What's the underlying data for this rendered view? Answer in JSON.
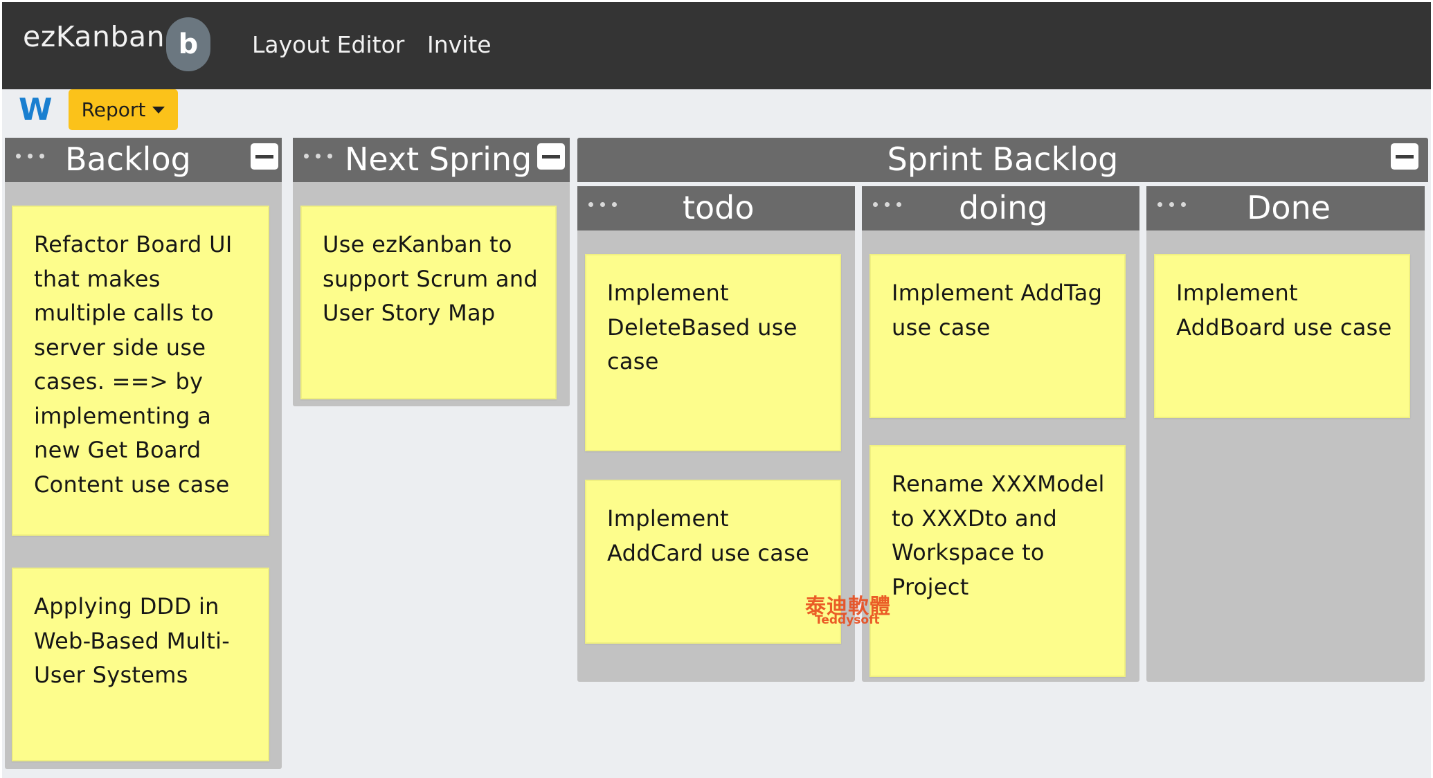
{
  "navbar": {
    "brand": "ezKanban",
    "badge": "b",
    "links": [
      "Layout Editor",
      "Invite"
    ]
  },
  "toolbar": {
    "workspace_logo": "W",
    "report_label": "Report"
  },
  "lanes": {
    "backlog": {
      "title": "Backlog",
      "cards": [
        "Refactor Board UI that makes multiple calls to server side use cases. ==> by implementing a new Get Board Content use case",
        "Applying DDD in Web-Based Multi-User Systems"
      ]
    },
    "next_spring": {
      "title": "Next Spring",
      "cards": [
        "Use ezKanban to support Scrum and User Story Map"
      ]
    },
    "sprint_backlog": {
      "title": "Sprint Backlog",
      "todo": {
        "title": "todo",
        "cards": [
          "Implement DeleteBased use case",
          "Implement AddCard use case"
        ]
      },
      "doing": {
        "title": "doing",
        "cards": [
          "Implement AddTag use case",
          "Rename XXXModel to XXXDto and Workspace to Project"
        ]
      },
      "done": {
        "title": "Done",
        "cards": [
          "Implement AddBoard use case"
        ]
      }
    }
  },
  "watermark": {
    "line1": "泰迪軟體",
    "line2": "Teddysoft"
  },
  "colors": {
    "navbar": "#343434",
    "lane_header": "#6a6a6a",
    "lane_body": "#c2c2c2",
    "card": "#fdfd8c",
    "report_button": "#fbc21a",
    "workspace_logo": "#1a7fd0"
  }
}
